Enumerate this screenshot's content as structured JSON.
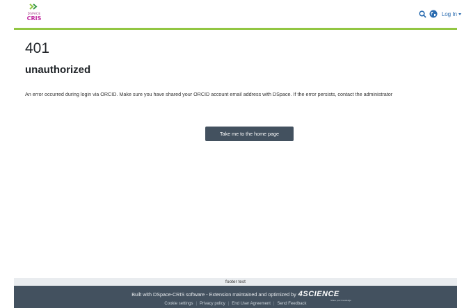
{
  "header": {
    "logo": {
      "small_text": "DSPACE",
      "word": "CRIS"
    },
    "login_label": "Log In"
  },
  "error": {
    "code": "401",
    "reason": "unauthorized",
    "message": "An error occurred during login via ORCID. Make sure you have shared your ORCID account email address with DSpace. If the error persists, contact the administrator",
    "home_button": "Take me to the home page"
  },
  "footer": {
    "top_text": "footer test",
    "built_text": "Built with DSpace-CRIS software - Extension maintained and optimized by",
    "brand": "4SCIENCE",
    "brand_tagline": "Share your knowledge",
    "links": [
      "Cookie settings",
      "Privacy policy",
      "End User Agreement",
      "Send Feedback"
    ]
  },
  "colors": {
    "accent_green": "#92c642",
    "button_bg": "#43515f",
    "link_blue": "#2b6cb0",
    "logo_magenta": "#c0269e"
  },
  "icons": [
    "dspace-cris-logo",
    "search-icon",
    "globe-icon",
    "chevron-down-icon"
  ]
}
